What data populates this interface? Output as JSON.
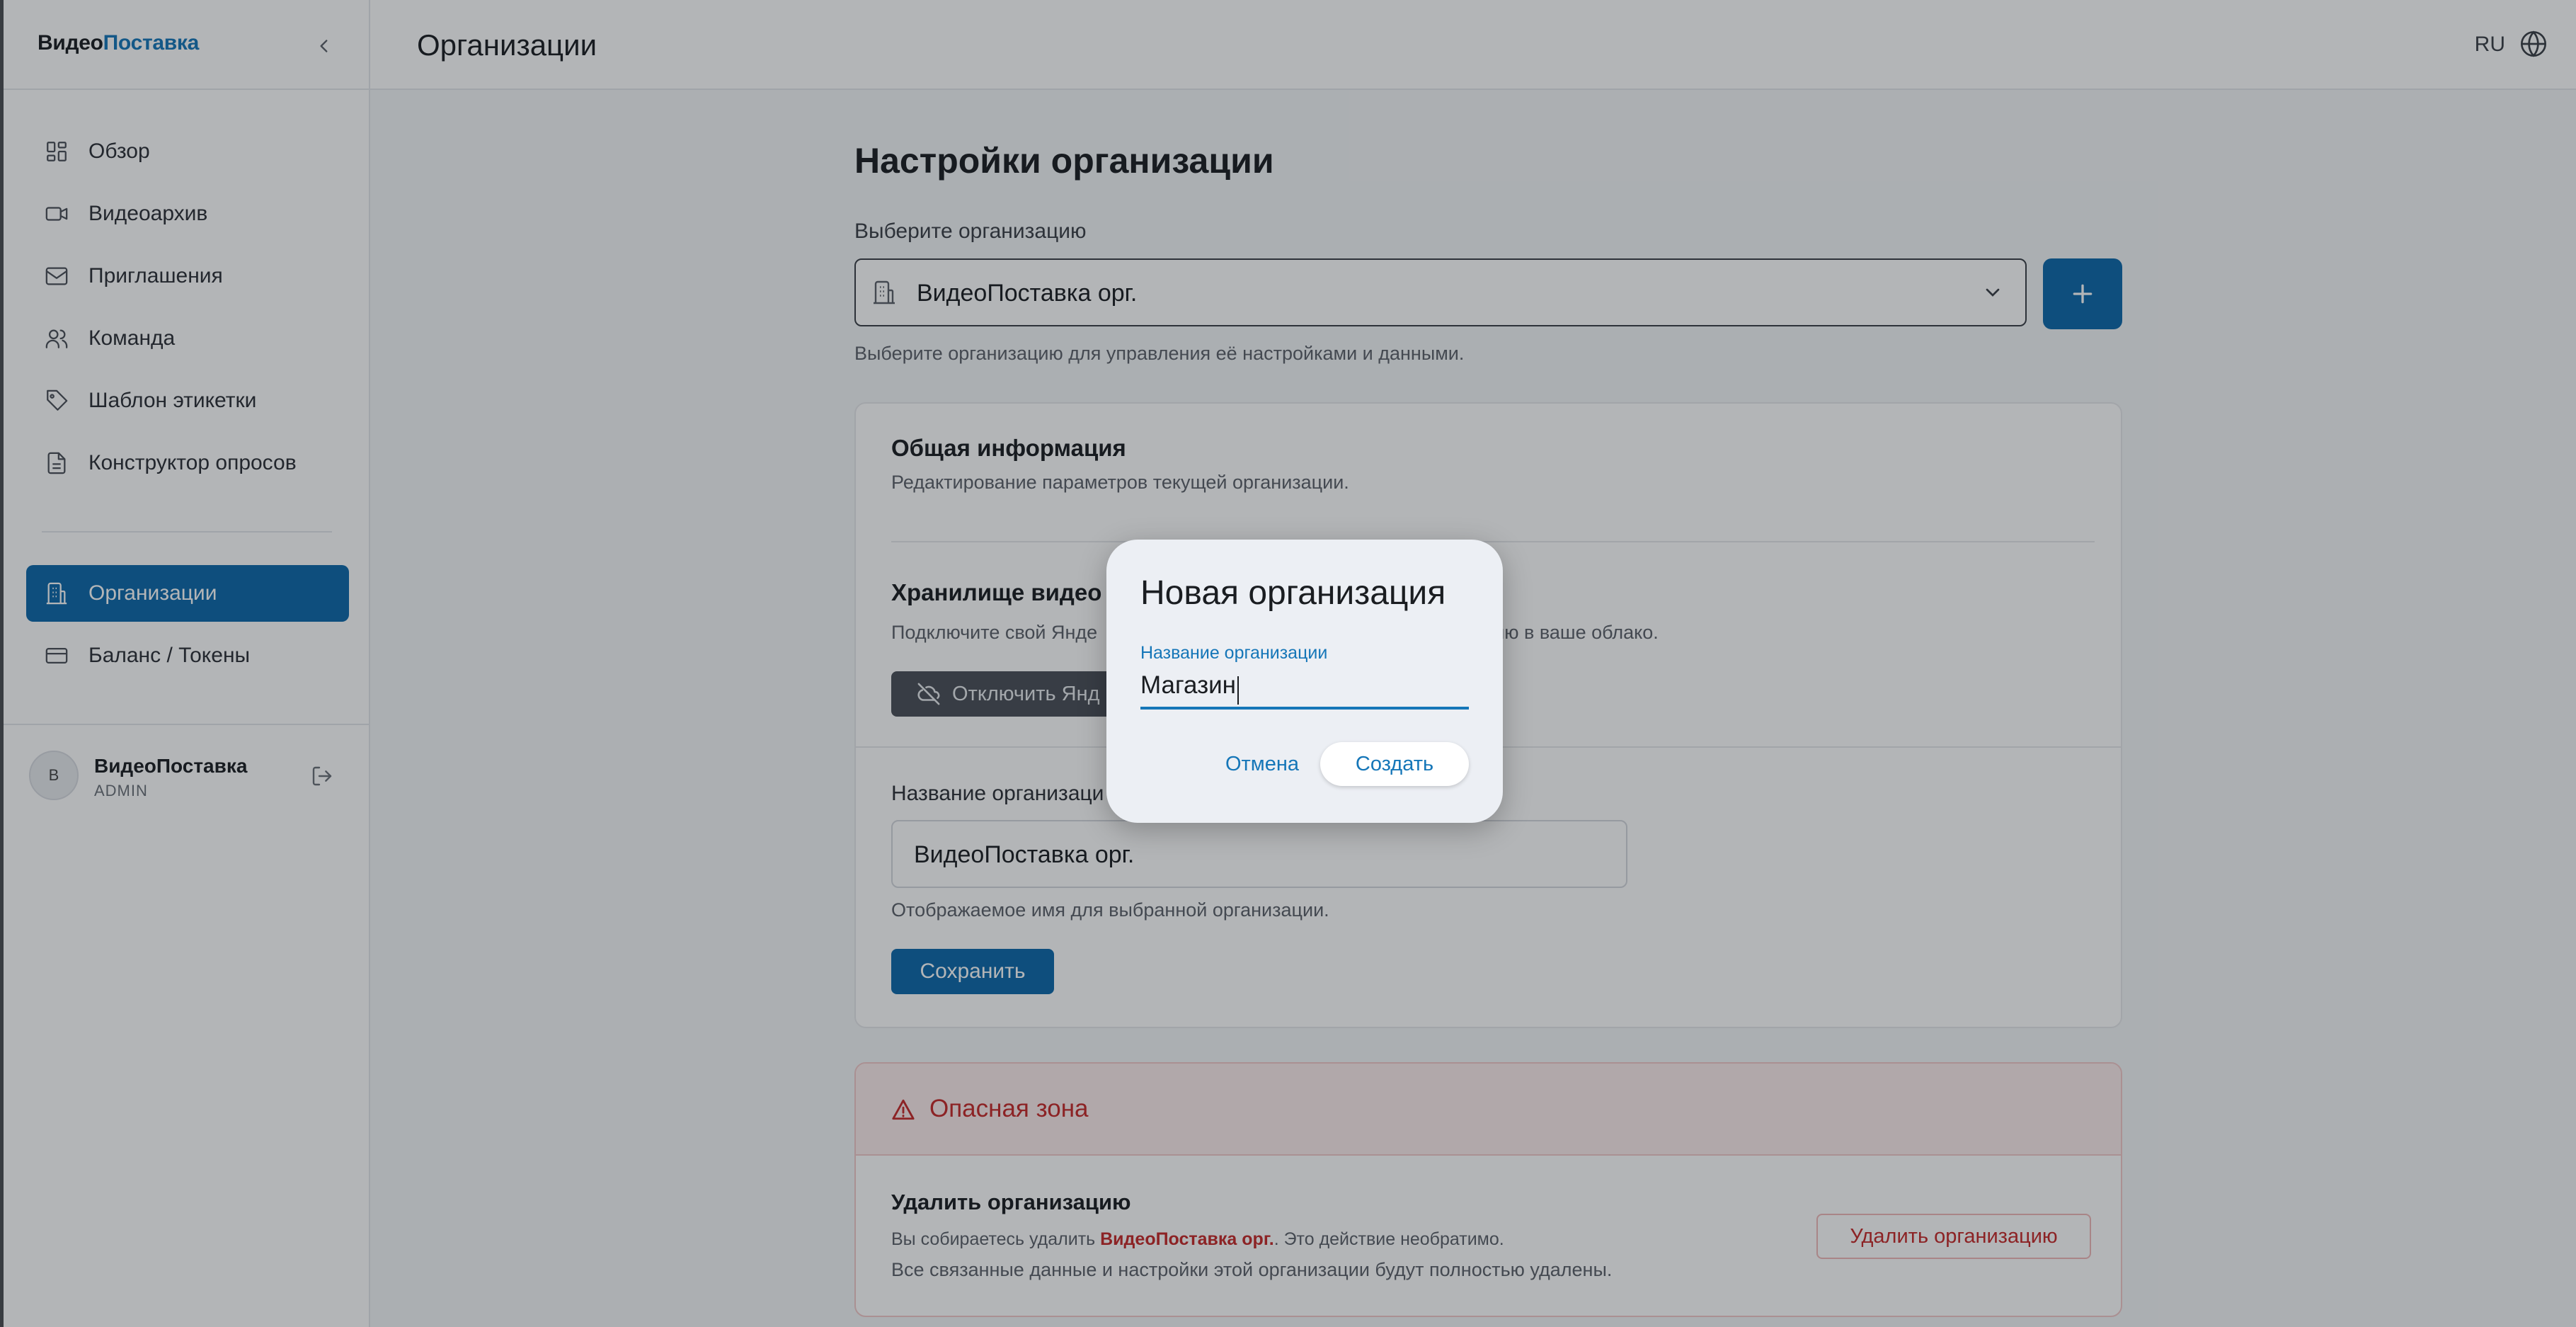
{
  "app": {
    "logo_part1": "Видео",
    "logo_part2": "Поставка"
  },
  "topbar": {
    "title": "Организации",
    "lang": "RU"
  },
  "sidebar": {
    "items": [
      {
        "label": "Обзор",
        "icon": "dashboard-icon"
      },
      {
        "label": "Видеоархив",
        "icon": "video-icon"
      },
      {
        "label": "Приглашения",
        "icon": "mail-icon"
      },
      {
        "label": "Команда",
        "icon": "users-icon"
      },
      {
        "label": "Шаблон этикетки",
        "icon": "tag-icon"
      },
      {
        "label": "Конструктор опросов",
        "icon": "document-icon"
      }
    ],
    "items2": [
      {
        "label": "Организации",
        "icon": "building-icon",
        "active": true
      },
      {
        "label": "Баланс / Токены",
        "icon": "card-icon"
      }
    ],
    "user": {
      "initial": "В",
      "name": "ВидеоПоставка",
      "role": "ADMIN"
    }
  },
  "main": {
    "title": "Настройки организации",
    "select_label": "Выберите организацию",
    "select_value": "ВидеоПоставка орг.",
    "select_help": "Выберите организацию для управления её настройками и данными.",
    "general": {
      "title": "Общая информация",
      "subtitle": "Редактирование параметров текущей организации."
    },
    "storage": {
      "title": "Хранилище видео (",
      "desc_start": "Подключите свой Янде",
      "desc_end": "ию в ваше облако.",
      "disconnect_label": "Отключить Янд"
    },
    "name_section": {
      "label": "Название организаци",
      "value": "ВидеоПоставка орг.",
      "help": "Отображаемое имя для выбранной организации.",
      "save_label": "Сохранить"
    },
    "danger": {
      "title": "Опасная зона",
      "delete_title": "Удалить организацию",
      "desc1_prefix": "Вы собираетесь удалить ",
      "desc1_org": "ВидеоПоставка орг.",
      "desc1_suffix": ". Это действие необратимо.",
      "desc2": "Все связанные данные и настройки этой организации будут полностью удалены.",
      "delete_label": "Удалить организацию"
    }
  },
  "dialog": {
    "title": "Новая организация",
    "field_label": "Название организации",
    "field_value": "Магазин",
    "cancel_label": "Отмена",
    "create_label": "Создать"
  },
  "colors": {
    "primary": "#0c68aa",
    "accent": "#1576b8",
    "danger": "#c62828"
  }
}
